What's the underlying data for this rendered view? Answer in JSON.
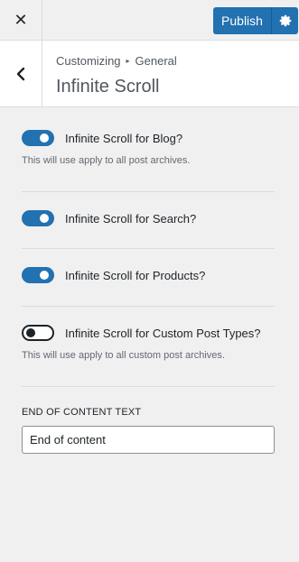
{
  "topbar": {
    "close_icon": "close-icon",
    "publish_label": "Publish",
    "gear_icon": "gear-icon"
  },
  "header": {
    "back_icon": "chevron-left-icon",
    "breadcrumb_root": "Customizing",
    "breadcrumb_separator": "▸",
    "breadcrumb_section": "General",
    "title": "Infinite Scroll"
  },
  "controls": [
    {
      "label": "Infinite Scroll for Blog?",
      "checked": true,
      "description": "This will use apply to all post archives."
    },
    {
      "label": "Infinite Scroll for Search?",
      "checked": true,
      "description": ""
    },
    {
      "label": "Infinite Scroll for Products?",
      "checked": true,
      "description": ""
    },
    {
      "label": "Infinite Scroll for Custom Post Types?",
      "checked": false,
      "description": "This will use apply to all custom post archives."
    }
  ],
  "end_of_content": {
    "label": "END OF CONTENT TEXT",
    "value": "End of content"
  },
  "colors": {
    "accent": "#2271b1",
    "panel_bg": "#f0f0f1",
    "header_bg": "#ffffff"
  }
}
